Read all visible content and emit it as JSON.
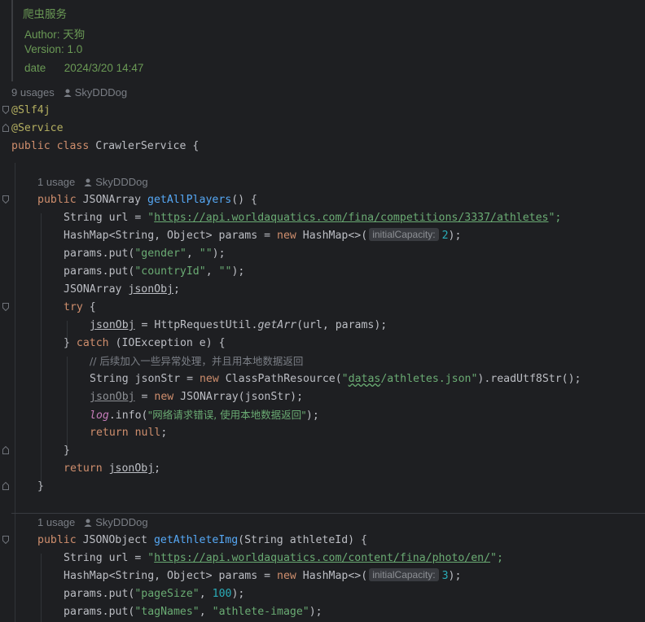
{
  "doc": {
    "title": "爬虫服务",
    "author_label": "Author:",
    "author_value": "天狗",
    "version_label": "Version:",
    "version_value": "1.0",
    "date_label": "date",
    "date_value": "2024/3/20 14:47"
  },
  "class_meta": {
    "usages": "9 usages",
    "author": "SkyDDDog"
  },
  "method1_meta": {
    "usages": "1 usage",
    "author": "SkyDDDog"
  },
  "method2_meta": {
    "usages": "1 usage",
    "author": "SkyDDDog"
  },
  "code": {
    "ann_slf4j": "@Slf4j",
    "ann_service": "@Service",
    "kw_public": "public",
    "kw_class": "class",
    "class_name": "CrawlerService {",
    "m1_sig_type": "JSONArray",
    "m1_name": "getAllPlayers",
    "m1_params": "() {",
    "l_url_decl": "String url = ",
    "l_url_q1": "\"",
    "url1": "https://api.worldaquatics.com/fina/competitions/3337/athletes",
    "l_url_end": "\";",
    "hm_decl": "HashMap<String, Object> params = ",
    "kw_new": "new",
    "hm_ctor": " HashMap<>(",
    "hint_capacity": "initialCapacity:",
    "num_2": "2",
    "close_paren_semi": ");",
    "put_gender_pre": "params.put(",
    "str_gender": "\"gender\"",
    "str_empty": "\"\"",
    "comma": ", ",
    "str_country": "\"countryId\"",
    "jsonarr_decl": "JSONArray ",
    "jsonobj_var": "jsonObj",
    "semi": ";",
    "kw_try": "try",
    "open_brace": " {",
    "assign_http": " = HttpRequestUtil.",
    "getarr": "getArr",
    "http_args": "(url, params);",
    "close_brace": "}",
    "kw_catch": "catch",
    "catch_args": " (IOException e) {",
    "comment_zh": "// 后续加入一些异常处理，并且用本地数据返回",
    "json_str_decl": "String jsonStr = ",
    "cpr": " ClassPathResource(",
    "str_datas_q": "\"",
    "str_datas": "datas",
    "str_datas_rest": "/athletes.json\"",
    "read_utf8": ").readUtf8Str();",
    "assign_new": " = ",
    "jsonarray_ctor": " JSONArray(jsonStr);",
    "log": "log",
    "info": ".info(",
    "str_err_zh": "\"网络请求错误, 使用本地数据返回\"",
    "kw_return": "return",
    "kw_null": "null",
    "return_obj_sp": " ",
    "m2_sig_type": "JSONObject",
    "m2_name": "getAthleteImg",
    "m2_params": "(String athleteId) {",
    "url2": "https://api.worldaquatics.com/content/fina/photo/en/",
    "num_3": "3",
    "str_pagesize": "\"pageSize\"",
    "num_100": "100",
    "str_tagnames": "\"tagNames\"",
    "str_athlete_image": "\"athlete-image\""
  }
}
